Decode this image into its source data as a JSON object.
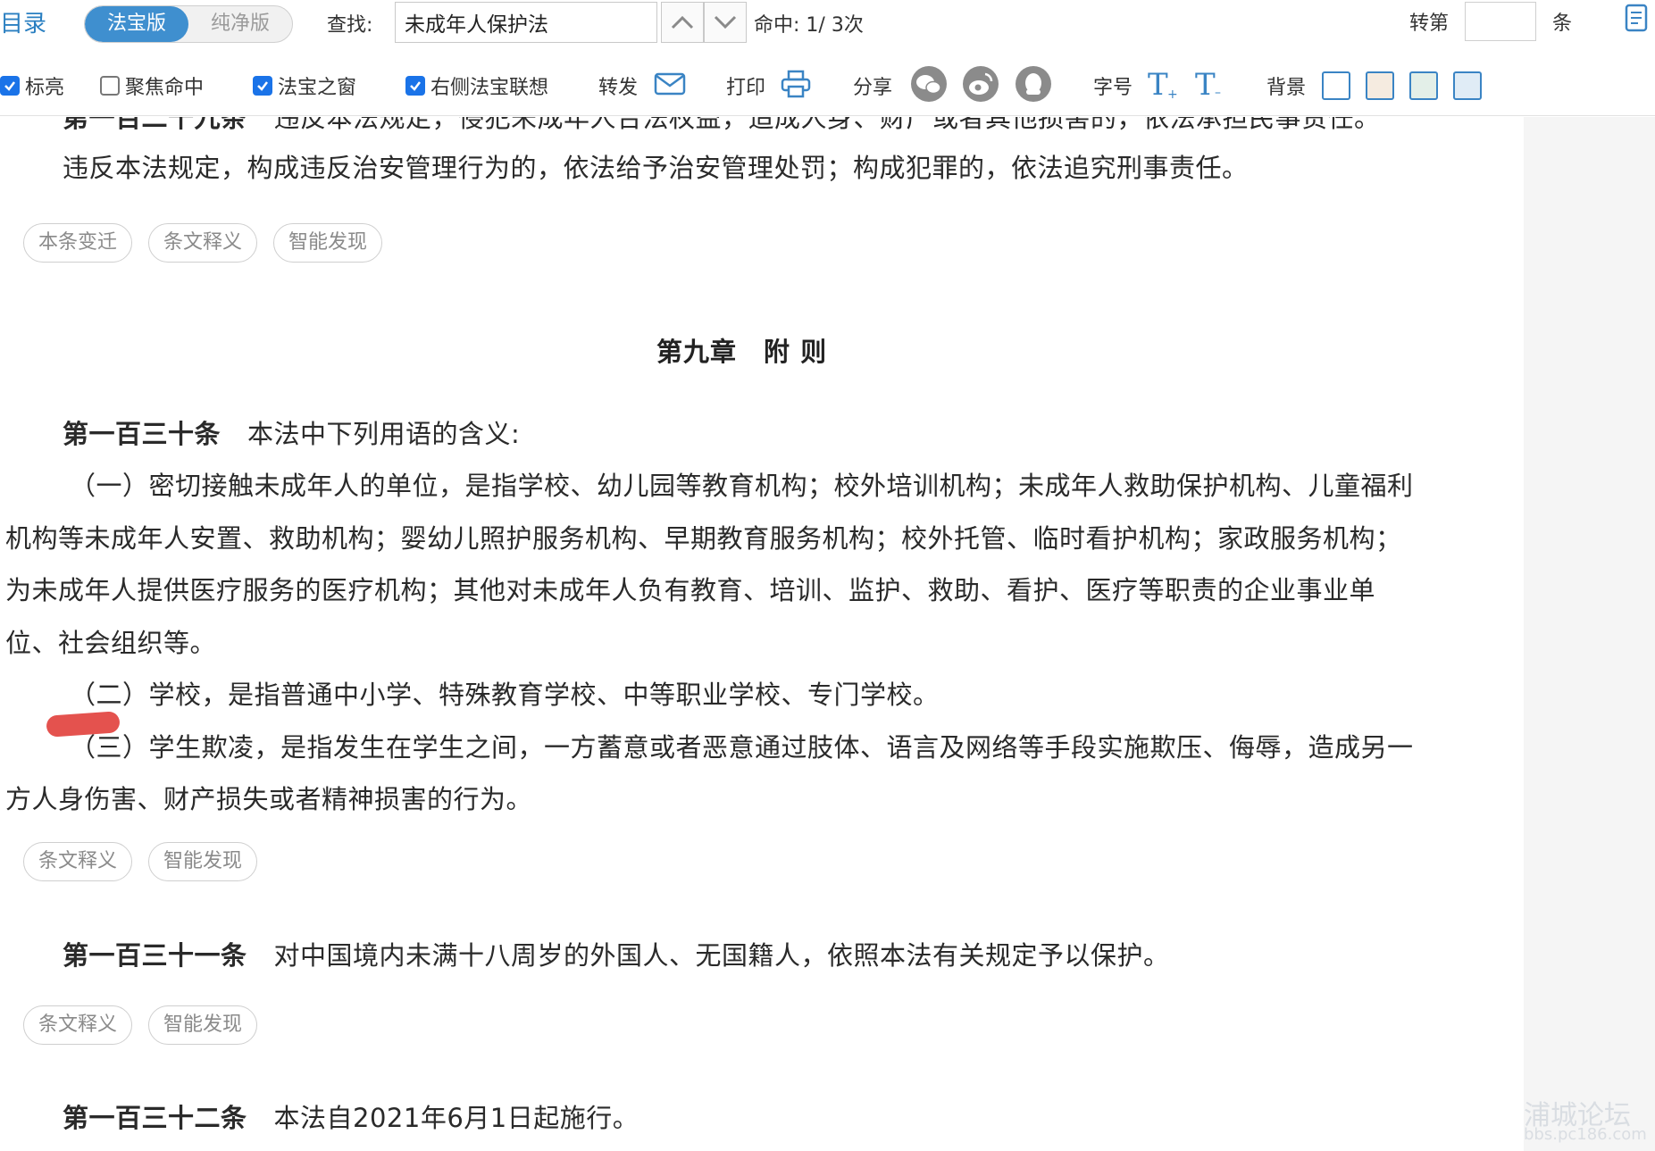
{
  "toolbar": {
    "toc_label": "目录",
    "mode_active": "法宝版",
    "mode_inactive": "纯净版",
    "find_label": "查找:",
    "find_value": "未成年人保护法",
    "hit_label": "命中:",
    "hit_value": "1/ 3次",
    "goto_label": "转第",
    "goto_unit": "条"
  },
  "options": {
    "highlight": {
      "label": "标亮",
      "checked": true
    },
    "focus": {
      "label": "聚焦命中",
      "checked": false
    },
    "window": {
      "label": "法宝之窗",
      "checked": true
    },
    "assoc": {
      "label": "右侧法宝联想",
      "checked": true
    },
    "forward_label": "转发",
    "print_label": "打印",
    "share_label": "分享",
    "fontsize_label": "字号",
    "background_label": "背景",
    "bg_colors": [
      "#ffffff",
      "#f5ebe0",
      "#e3efe8",
      "#e0ecf6"
    ]
  },
  "content": {
    "article129_header": "第一百二十九条",
    "article129_line1": "违反本法规定，侵犯未成年人合法权益，造成人身、财产或者其他损害的，依法承担民事责任。",
    "article129_line2": "违反本法规定，构成违反治安管理行为的，依法给予治安管理处罚；构成犯罪的，依法追究刑事责任。",
    "chips1": [
      "本条变迁",
      "条文释义",
      "智能发现"
    ],
    "chapter": "第九章　附 则",
    "article130_no": "第一百三十条",
    "article130_text": "本法中下列用语的含义:",
    "item1_line1": "（一）密切接触未成年人的单位，是指学校、幼儿园等教育机构；校外培训机构；未成年人救助保护机构、儿童福利",
    "item1_line2": "机构等未成年人安置、救助机构；婴幼儿照护服务机构、早期教育服务机构；校外托管、临时看护机构；家政服务机构；",
    "item1_line3": "为未成年人提供医疗服务的医疗机构；其他对未成年人负有教育、培训、监护、救助、看护、医疗等职责的企业事业单",
    "item1_line4": "位、社会组织等。",
    "item2": "（二）学校，是指普通中小学、特殊教育学校、中等职业学校、专门学校。",
    "item3_line1": "（三）学生欺凌，是指发生在学生之间，一方蓄意或者恶意通过肢体、语言及网络等手段实施欺压、侮辱，造成另一",
    "item3_line2": "方人身伤害、财产损失或者精神损害的行为。",
    "chips2": [
      "条文释义",
      "智能发现"
    ],
    "article131_no": "第一百三十一条",
    "article131_text": "对中国境内未满十八周岁的外国人、无国籍人，依照本法有关规定予以保护。",
    "chips3": [
      "条文释义",
      "智能发现"
    ],
    "article132_no": "第一百三十二条",
    "article132_text": "本法自2021年6月1日起施行。"
  },
  "watermark": {
    "line1": "浦城论坛",
    "line2": "bbs.pc186.com"
  },
  "colors": {
    "accent": "#3f8fcf",
    "mark": "#e2433f"
  }
}
